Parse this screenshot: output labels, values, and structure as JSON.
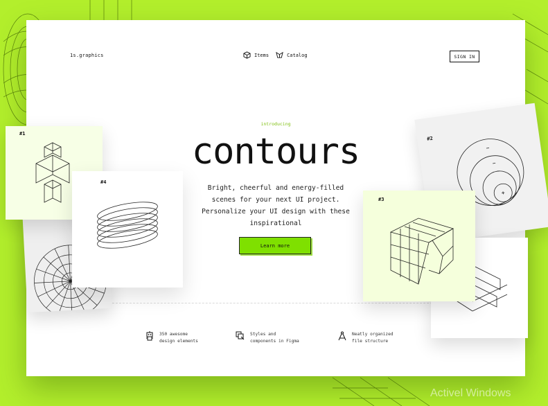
{
  "nav": {
    "logo": "1s.graphics",
    "items": [
      {
        "label": "Items",
        "icon": "cube-icon"
      },
      {
        "label": "Catalog",
        "icon": "cube-outline-icon"
      }
    ],
    "signin_label": "SIGN IN"
  },
  "hero": {
    "intro": "introducing",
    "title": "contours",
    "description_lines": [
      "Bright, cheerful and energy-filled",
      "scenes for your next UI project.",
      "Personalize your UI design with these",
      "inspirational"
    ],
    "cta_label": "Learn more"
  },
  "features": [
    {
      "icon": "robot-icon",
      "lines": [
        "350 awesome",
        "design elements"
      ]
    },
    {
      "icon": "components-icon",
      "lines": [
        "Styles and",
        "components in Figma"
      ]
    },
    {
      "icon": "compass-icon",
      "lines": [
        "Neatly organized",
        "file structure"
      ]
    }
  ],
  "cards": [
    {
      "label": "#1",
      "shape": "stacked-cubes"
    },
    {
      "label": "#4",
      "shape": "spring-coil"
    },
    {
      "label": "#2",
      "shape": "nested-circles"
    },
    {
      "label": "#3",
      "shape": "twisted-cube"
    }
  ],
  "watermark": "Activel Windows",
  "colors": {
    "background": "#b3ef2c",
    "cta": "#7fe000",
    "intro": "#7fbf10",
    "card": "#f4f4f4"
  }
}
